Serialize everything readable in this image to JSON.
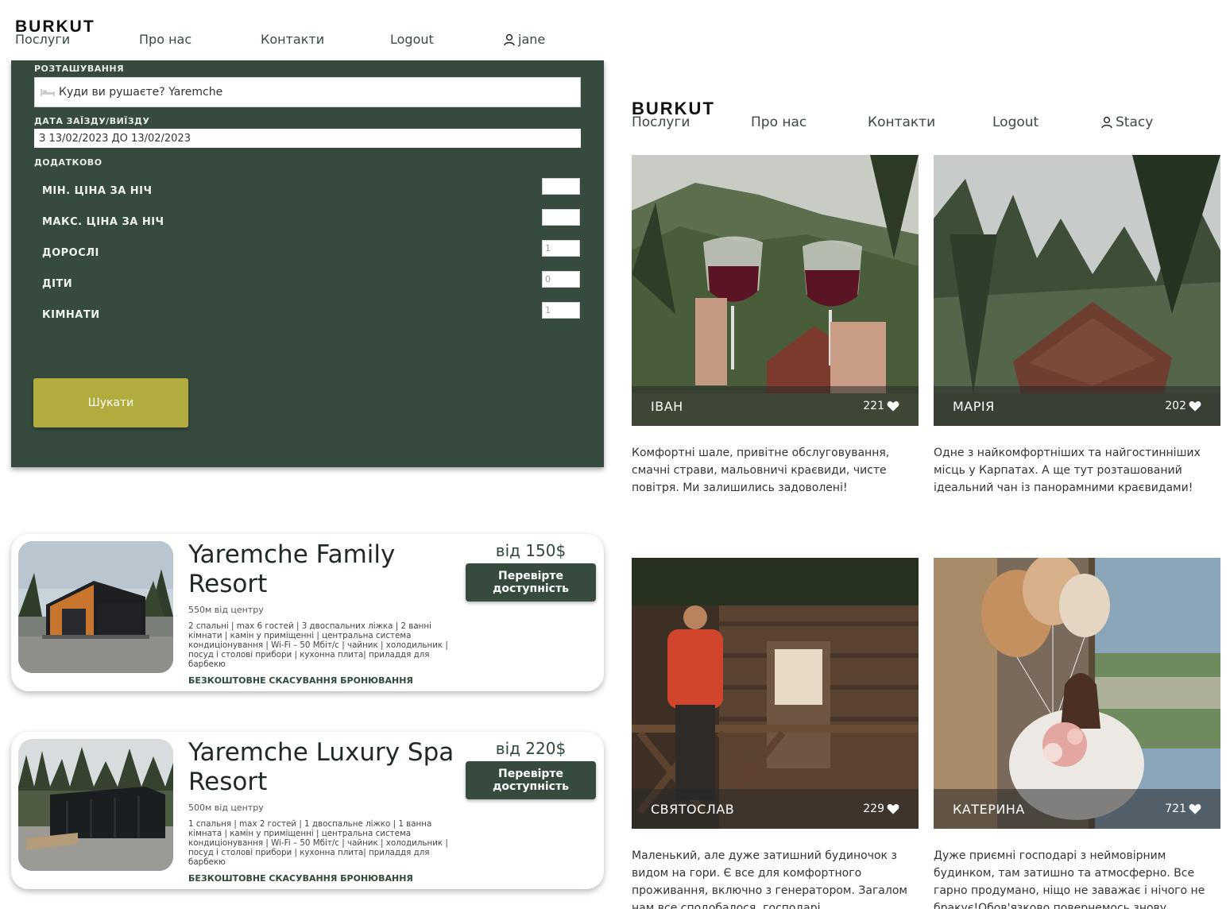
{
  "nav_left": {
    "brand": "BURKUT",
    "items": [
      "Послуги",
      "Про нас",
      "Контакти",
      "Logout"
    ],
    "user": "jane"
  },
  "nav_right": {
    "brand": "BURKUT",
    "items": [
      "Послуги",
      "Про нас",
      "Контакти",
      "Logout"
    ],
    "user": "Stacy"
  },
  "search": {
    "location_label": "РОЗТАШУВАННЯ",
    "location_value": "Куди ви рушаєте? Yaremche",
    "dates_label": "ДАТА ЗАЇЗДУ/ВИЇЗДУ",
    "dates_value": "З 13/02/2023 ДО 13/02/2023",
    "extra_label": "ДОДАТКОВО",
    "filters": [
      {
        "label": "МІН. ЦІНА ЗА НІЧ",
        "value": ""
      },
      {
        "label": "МАКС. ЦІНА ЗА НІЧ",
        "value": ""
      },
      {
        "label": "ДОРОСЛІ",
        "value": "1"
      },
      {
        "label": "ДІТИ",
        "value": "0"
      },
      {
        "label": "КІМНАТИ",
        "value": "1"
      }
    ],
    "button": "Шукати"
  },
  "listings": [
    {
      "title": "Yaremche Family Resort",
      "distance": "550м від центру",
      "description": "2 спальні | max 6 гостей | 3 двоспальних ліжка | 2 ванні кімнати | камін у приміщенні | центральна система кондиціонування | Wi-Fi – 50 Мбіт/с | чайник | холодильник | посуд і столові прибори | кухонна плита| приладдя для барбекю",
      "cancellation": "БЕЗКОШТОВНЕ СКАСУВАННЯ БРОНЮВАННЯ",
      "price": "від 150$",
      "button": "Перевірте доступність"
    },
    {
      "title": "Yaremche Luxury Spa Resort",
      "distance": "500м від центру",
      "description": "1 спальня | max 2 гостей | 1 двоспальне ліжко | 1 ванна кімната | камін у приміщенні | центральна система кондиціонування | Wi-Fi – 50 Мбіт/с | чайник | холодильник | посуд і столові прибори | кухонна плита| приладдя для барбекю",
      "cancellation": "БЕЗКОШТОВНЕ СКАСУВАННЯ БРОНЮВАННЯ",
      "price": "від 220$",
      "button": "Перевірте доступність"
    }
  ],
  "reviews": [
    {
      "name": "ІВАН",
      "likes": "221",
      "text": "Комфортні шале, привітне обслуговування, смачні страви, мальовничі краєвиди, чисте повітря. Ми залишились задоволені!"
    },
    {
      "name": "МАРІЯ",
      "likes": "202",
      "text": "Одне з найкомфортніших та найгостинніших місць у Карпатах. А ще тут розташований ідеальний чан із панорамними краєвидами!"
    },
    {
      "name": "СВЯТОСЛАВ",
      "likes": "229",
      "text": "Маленький, але дуже затишний будиночок з видом на гори. Є все для комфортного проживання, включно з генератором. Загалом нам все сподобалося, господарі"
    },
    {
      "name": "КАТЕРИНА",
      "likes": "721",
      "text": "Дуже приємні господарі з неймовірним будинком, там затишно та атмосферно. Все гарно продумано, ніщо не заважає і нічого не бракує!Обов'язково повернемось знову"
    }
  ],
  "colors": {
    "panel": "#364b3d",
    "search_button": "#b1ac3d",
    "accent_text": "#2f4a36"
  }
}
